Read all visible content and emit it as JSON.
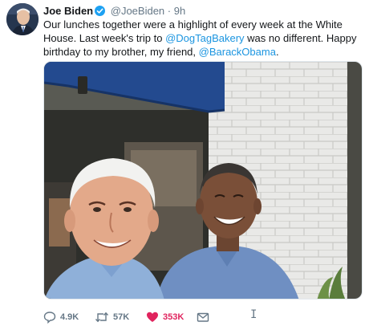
{
  "tweet": {
    "author_name": "Joe Biden",
    "handle": "@JoeBiden",
    "separator": "·",
    "time": "9h",
    "text_part1": "Our lunches together were a highlight of every week at the White House. Last week's trip to ",
    "mention1": "@DogTagBakery",
    "text_part2": " was no different. Happy birthday to my brother, my friend, ",
    "mention2": "@BarackObama",
    "text_part3": ".",
    "photo_alt": "Selfie of Joe Biden and Barack Obama outside a brick building"
  },
  "actions": {
    "replies": "4.9K",
    "retweets": "57K",
    "likes": "353K"
  },
  "icons": {
    "verified": "verified-badge-icon",
    "reply": "reply-icon",
    "retweet": "retweet-icon",
    "like": "heart-icon",
    "dm": "envelope-icon",
    "cursor": "text-cursor-icon"
  },
  "colors": {
    "link": "#1b95e0",
    "verified": "#1da1f2",
    "like": "#e0245e",
    "muted": "#657786"
  }
}
